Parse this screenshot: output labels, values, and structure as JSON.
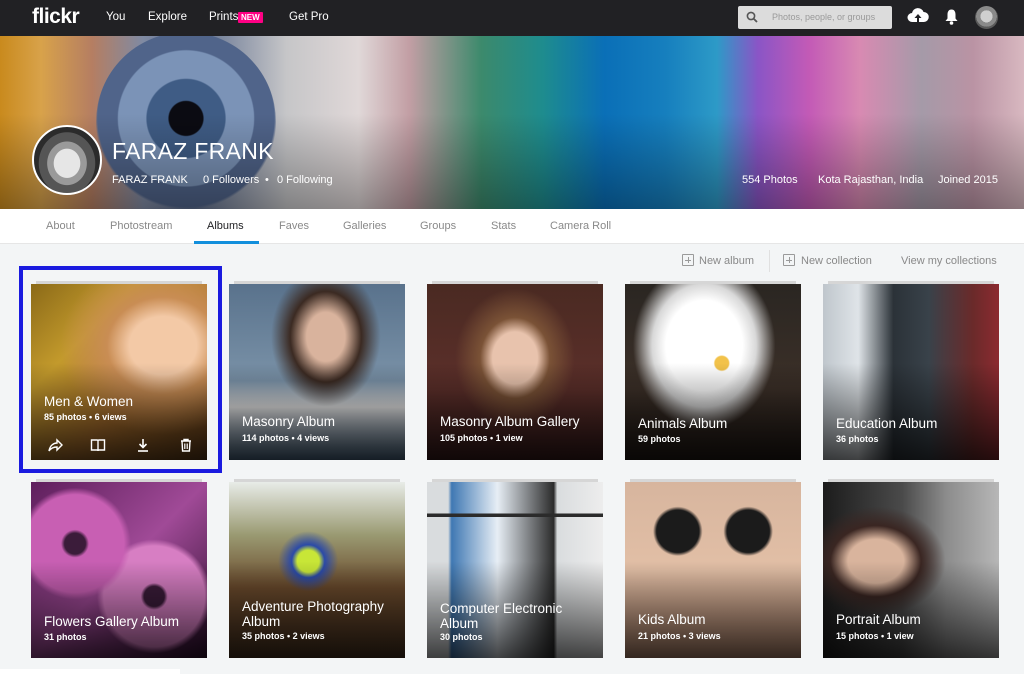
{
  "nav": {
    "logo": "flickr",
    "links": [
      "You",
      "Explore",
      "Prints",
      "Get Pro"
    ],
    "prints_badge": "NEW",
    "search_placeholder": "Photos, people, or groups",
    "icons": [
      "search-icon",
      "upload-cloud-icon",
      "bell-icon",
      "user-avatar"
    ]
  },
  "profile": {
    "name": "FARAZ FRANK",
    "username": "FARAZ FRANK",
    "followers": "0 Followers",
    "following": "0 Following",
    "photos": "554 Photos",
    "location": "Kota Rajasthan, India",
    "joined": "Joined 2015"
  },
  "tabs": [
    {
      "label": "About",
      "active": false
    },
    {
      "label": "Photostream",
      "active": false
    },
    {
      "label": "Albums",
      "active": true
    },
    {
      "label": "Faves",
      "active": false
    },
    {
      "label": "Galleries",
      "active": false
    },
    {
      "label": "Groups",
      "active": false
    },
    {
      "label": "Stats",
      "active": false
    },
    {
      "label": "Camera Roll",
      "active": false
    }
  ],
  "toolbar": {
    "new_album": "New album",
    "new_collection": "New collection",
    "view_collections": "View my collections"
  },
  "albums": [
    {
      "title": "Men & Women",
      "meta": "85 photos  •  6 views",
      "selected": true,
      "actions": [
        "share-icon",
        "book-icon",
        "download-icon",
        "trash-icon"
      ]
    },
    {
      "title": "Masonry Album",
      "meta": "114 photos  •  4 views"
    },
    {
      "title": "Masonry Album Gallery",
      "meta": "105 photos  •  1 view"
    },
    {
      "title": "Animals Album",
      "meta": "59 photos"
    },
    {
      "title": "Education Album",
      "meta": "36 photos"
    },
    {
      "title": "Flowers Gallery Album",
      "meta": "31 photos"
    },
    {
      "title": "Adventure Photography Album",
      "meta": "35 photos  •  2 views"
    },
    {
      "title": "Computer Electronic Album",
      "meta": "30 photos"
    },
    {
      "title": "Kids Album",
      "meta": "21 photos  •  3 views"
    },
    {
      "title": "Portrait Album",
      "meta": "15 photos  •  1 view"
    }
  ],
  "colors": {
    "nav_bg": "#212124",
    "badge": "#ff0084",
    "tab_underline": "#128fdc",
    "selection_border": "#1a1adf"
  }
}
